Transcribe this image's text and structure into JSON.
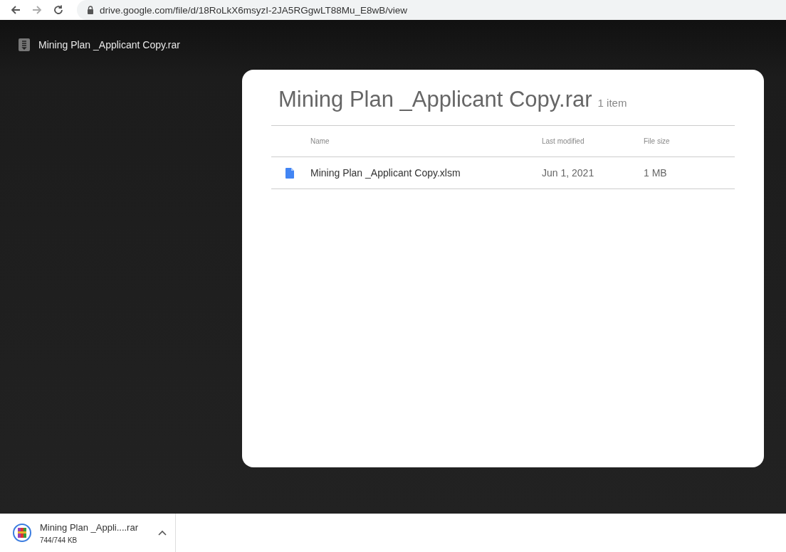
{
  "browser": {
    "url": "drive.google.com/file/d/18RoLkX6msyzI-2JA5RGgwLT88Mu_E8wB/view"
  },
  "viewer": {
    "title": "Mining Plan _Applicant Copy.rar"
  },
  "archive": {
    "title": "Mining Plan _Applicant Copy.rar",
    "count": "1 item",
    "columns": [
      "Name",
      "Last modified",
      "File size"
    ],
    "rows": [
      {
        "name": "Mining Plan _Applicant Copy.xlsm",
        "modified": "Jun 1, 2021",
        "size": "1 MB"
      }
    ]
  },
  "download": {
    "name": "Mining Plan _Appli....rar",
    "transferred": "744/744 KB"
  }
}
